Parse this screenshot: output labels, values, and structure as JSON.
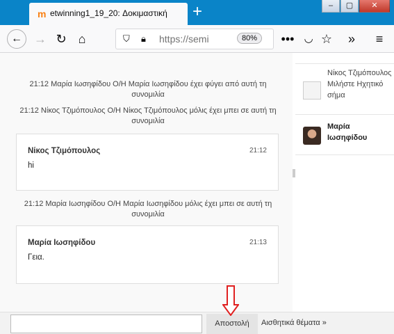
{
  "browser": {
    "tab_title": "etwinning1_19_20: Δοκιμαστική",
    "tab_icon_glyph": "m",
    "new_tab_glyph": "+",
    "url": "https://semi",
    "zoom": "80%"
  },
  "system_messages": [
    "21:12 Μαρία Ιωσηφίδου Ο/Η Μαρία Ιωσηφίδου έχει φύγει από αυτή τη συνομιλία",
    "21:12 Νίκος Τζιμόπουλος Ο/Η Νίκος Τζιμόπουλος μόλις έχει μπει σε αυτή τη συνομιλία",
    "21:12 Μαρία Ιωσηφίδου Ο/Η Μαρία Ιωσηφίδου μόλις έχει μπει σε αυτή τη συνομιλία"
  ],
  "messages": [
    {
      "author": "Νίκος Τζιμόπουλος",
      "time": "21:12",
      "text": "hi"
    },
    {
      "author": "Μαρία Ιωσηφίδου",
      "time": "21:13",
      "text": "Γεια."
    }
  ],
  "users": [
    {
      "name": "Νίκος Τζιμόπουλος",
      "status": "Μιλήστε Ηχητικό σήμα"
    },
    {
      "name": "Μαρία Ιωσηφίδου"
    }
  ],
  "composer": {
    "input_value": "",
    "send_label": "Αποστολή",
    "themes_label": "Αισθητικά θέματα »"
  },
  "colors": {
    "titlebar": "#0a84c8",
    "arrow": "#e02020"
  }
}
